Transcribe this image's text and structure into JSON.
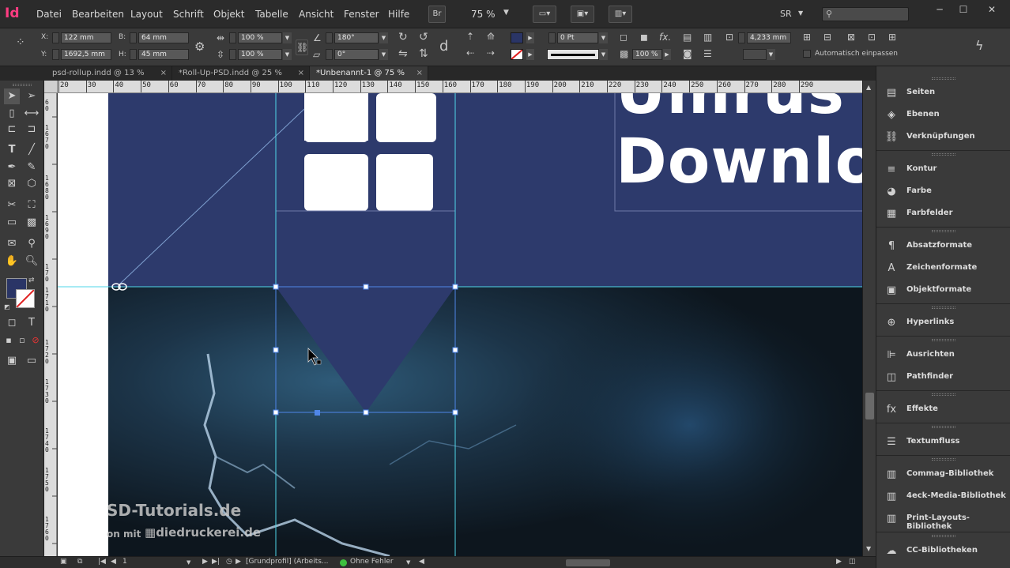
{
  "app": {
    "logo": "Id"
  },
  "menu": [
    "Datei",
    "Bearbeiten",
    "Layout",
    "Schrift",
    "Objekt",
    "Tabelle",
    "Ansicht",
    "Fenster",
    "Hilfe"
  ],
  "menubar": {
    "bridge": "Br",
    "zoom": "75 %",
    "user": "SR",
    "search_placeholder": ""
  },
  "window": {
    "minimize": "─",
    "restore": "☐",
    "close": "✕"
  },
  "control": {
    "x_label": "X:",
    "x_value": "122 mm",
    "y_label": "Y:",
    "y_value": "1692,5 mm",
    "w_label": "B:",
    "w_value": "64 mm",
    "h_label": "H:",
    "h_value": "45 mm",
    "scale_x": "100 %",
    "scale_y": "100 %",
    "rotation": "180°",
    "shear": "0°",
    "stroke_weight": "0 Pt",
    "opacity": "100 %",
    "dimension": "4,233 mm",
    "auto_fit": "Automatisch einpassen",
    "fill_color": "#2a3566"
  },
  "tabs": [
    {
      "label": "psd-rollup.indd @ 13 %",
      "close": "×",
      "active": false
    },
    {
      "label": "*Roll-Up-PSD.indd @ 25 %",
      "close": "×",
      "active": false
    },
    {
      "label": "*Unbenannt-1 @ 75 %",
      "close": "×",
      "active": true
    }
  ],
  "hruler_ticks": [
    "20",
    "30",
    "40",
    "50",
    "60",
    "70",
    "80",
    "90",
    "100",
    "110",
    "120",
    "130",
    "140",
    "150",
    "160",
    "170",
    "180",
    "190",
    "200",
    "210",
    "220",
    "230",
    "240",
    "250",
    "260",
    "270",
    "280",
    "290"
  ],
  "canvas": {
    "headline": "Download",
    "watermark_line1": "SD-Tutorials.de",
    "watermark_line2": "on mit",
    "watermark_brand": "diedruckerei.de",
    "banner_color": "#2d3a6c"
  },
  "panels": [
    {
      "label": "Seiten",
      "icon": "pages-icon",
      "glyph": "▤"
    },
    {
      "label": "Ebenen",
      "icon": "layers-icon",
      "glyph": "◈"
    },
    {
      "label": "Verknüpfungen",
      "icon": "links-icon",
      "glyph": "⛓"
    },
    {
      "label": "Kontur",
      "icon": "stroke-icon",
      "glyph": "≡"
    },
    {
      "label": "Farbe",
      "icon": "color-icon",
      "glyph": "◕"
    },
    {
      "label": "Farbfelder",
      "icon": "swatches-icon",
      "glyph": "▦"
    },
    {
      "label": "Absatzformate",
      "icon": "paragraph-styles-icon",
      "glyph": "¶"
    },
    {
      "label": "Zeichenformate",
      "icon": "character-styles-icon",
      "glyph": "A"
    },
    {
      "label": "Objektformate",
      "icon": "object-styles-icon",
      "glyph": "▣"
    },
    {
      "label": "Hyperlinks",
      "icon": "hyperlinks-icon",
      "glyph": "⊕"
    },
    {
      "label": "Ausrichten",
      "icon": "align-icon",
      "glyph": "⊫"
    },
    {
      "label": "Pathfinder",
      "icon": "pathfinder-icon",
      "glyph": "◫"
    },
    {
      "label": "Effekte",
      "icon": "effects-icon",
      "glyph": "fx"
    },
    {
      "label": "Textumfluss",
      "icon": "text-wrap-icon",
      "glyph": "☰"
    },
    {
      "label": "Commag-Bibliothek",
      "icon": "library-icon",
      "glyph": "▥"
    },
    {
      "label": "4eck-Media-Bibliothek",
      "icon": "library-icon",
      "glyph": "▥"
    },
    {
      "label": "Print-Layouts-Bibliothek",
      "icon": "library-icon",
      "glyph": "▥"
    },
    {
      "label": "CC-Bibliotheken",
      "icon": "cc-libraries-icon",
      "glyph": "☁"
    }
  ],
  "status": {
    "page": "1",
    "profile": "[Grundprofil] (Arbeits...",
    "preflight": "Ohne Fehler",
    "preflight_color": "#3fbf3f"
  }
}
